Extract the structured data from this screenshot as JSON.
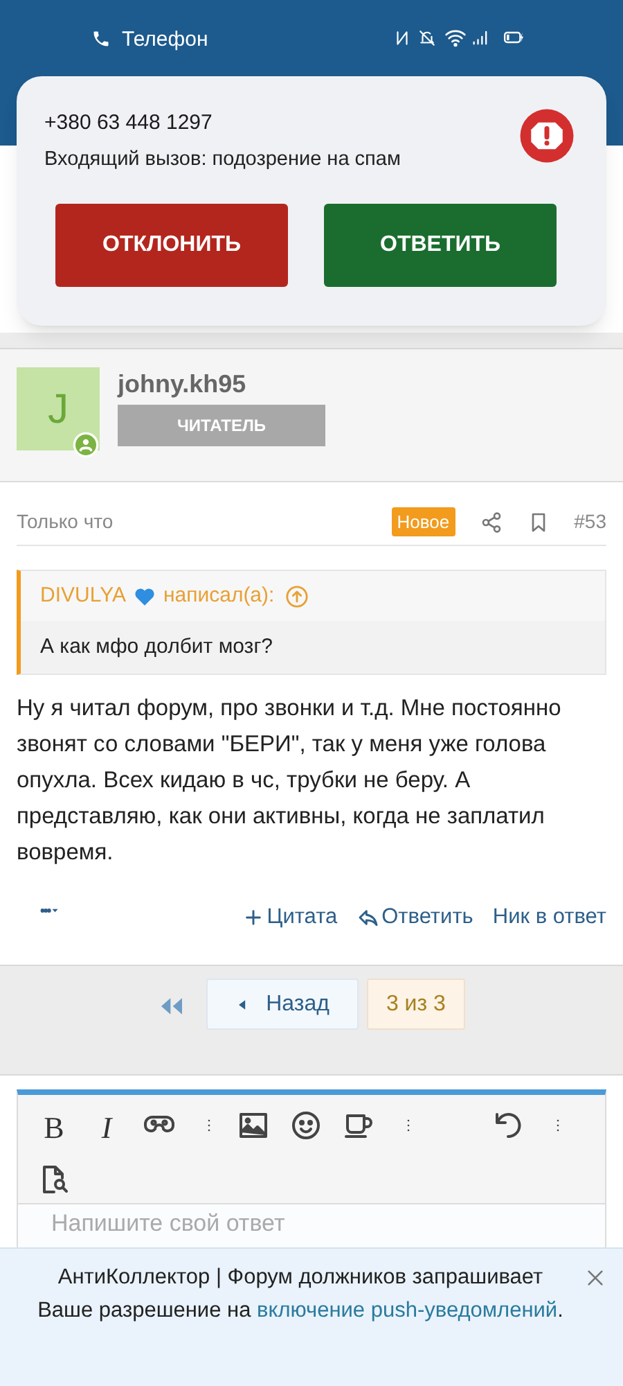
{
  "status_bar": {
    "app": "Телефон"
  },
  "incoming_call": {
    "number": "+380 63 448 1297",
    "subtitle": "Входящий вызов: подозрение на спам",
    "buttons": [
      {
        "label": "ОТКЛОНИТЬ",
        "kind": "decline"
      },
      {
        "label": "ОТВЕТИТЬ",
        "kind": "answer"
      }
    ]
  },
  "post": {
    "author": {
      "initial": "J",
      "name": "johny.kh95",
      "role": "ЧИТАТЕЛЬ",
      "online": true
    },
    "time": "Только что",
    "badge": "Новое",
    "number": "#53",
    "quote": {
      "author": "DIVULYA",
      "attribution": "написал(а):",
      "text": "А как мфо долбит мозг?"
    },
    "body": "Ну я читал форум, про звонки и т.д. Мне постоянно звонят со словами \"БЕРИ\", так у меня уже голова опухла. Всех кидаю в чс, трубки не беру. А представляю, как они активны, когда не заплатил вовремя.",
    "actions": [
      {
        "label": "Цитата",
        "kind": "quote"
      },
      {
        "label": "Ответить",
        "kind": "reply"
      },
      {
        "label": "Ник в ответ",
        "kind": "mention"
      }
    ]
  },
  "pagination": {
    "back": "Назад",
    "current": "3 из 3"
  },
  "editor": {
    "toolbar": [
      {
        "kind": "bold",
        "label": "B"
      },
      {
        "kind": "italic",
        "label": "I"
      },
      {
        "kind": "gamepad"
      },
      {
        "kind": "more"
      },
      {
        "kind": "image"
      },
      {
        "kind": "smiley"
      },
      {
        "kind": "mug"
      },
      {
        "kind": "more"
      },
      {
        "kind": "spacer"
      },
      {
        "kind": "undo"
      },
      {
        "kind": "more"
      },
      {
        "kind": "preview"
      }
    ],
    "placeholder": "Напишите свой ответ"
  },
  "push_banner": {
    "text": "АнтиКоллектор | Форум должников запрашивает Ваше разрешение на ",
    "link": "включение push-уведомлений",
    "after": "."
  }
}
